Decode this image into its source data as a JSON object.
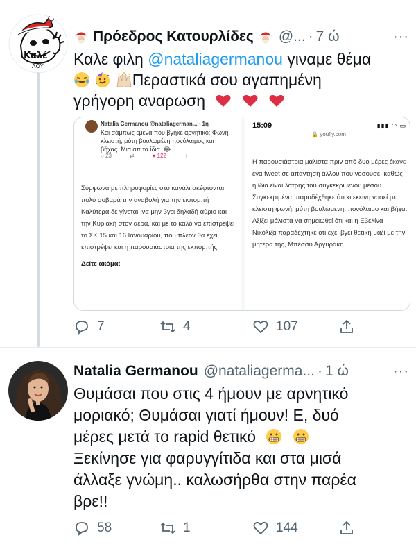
{
  "tweet1": {
    "name": "Πρόεδρος Κατουρλίδες",
    "handle": "@...",
    "time": "7 ώ",
    "more": "···",
    "text_line1_pre": "Καλε φιλη ",
    "mention": "@nataliagermanou",
    "text_line1_post": " γιναμε θέμα",
    "text_line2": "Περαστικά σου αγαπημένη",
    "text_line3": "γρήγορη αναρωση",
    "embedded": {
      "mini_name": "Natalia Germanou @nataliagerman... · 1η",
      "mini_body": "Και σάμπως εμένα που βγήκε αρνητικό; Φωνή κλειστή, μύτη βουλωμένη πονόλαιμος και βήχας. Μια απ τα ίδια. 😂",
      "mini_reply": "23",
      "mini_like": "122",
      "article_left": "Σύμφωνα με πληροφορίες στο κανάλι σκέφτονται πολύ σοβαρά την αναβολή για την εκπομπή Καλύτερα δε γίνεται, να μην βγει δηλαδή αύριο και την Κυριακή στον αέρα, και με το καλό να επιστρέψει το ΣΚ 15 και 16 Ιανουαρίου, που πλέον θα έχει επιστρέψει και η παρουσιάστρια της εκπομπής.",
      "see_more": "Δείτε ακόμα:",
      "phone_time": "15:09",
      "site": "youfly.com",
      "article_right": "Η παρουσιάστρια μάλιστα πριν από δυο μέρες έκανε ένα tweet σε απάντηση άλλου που νοσούσε, καθώς η ίδια είναι λάτρης του συγκεκριμένου μέσου. Συγκεκριμένα, παραδέχθηκε ότι κι εκείνη νοσεί με κλειστή φωνή, μύτη βουλωμένη, πονόλαιμο και βήχα. Αξίζει μάλιστα να σημειωθεί ότι και η Εβελίνα Νικόλιζα παραδέχτηκε ότι έχει βγει θετική μαζί με την μητέρα της, Μπέσσυ Αργυράκη."
    },
    "replies": "7",
    "retweets": "4",
    "likes": "107"
  },
  "tweet2": {
    "name": "Natalia Germanou",
    "handle": "@nataliagerma...",
    "time": "1 ώ",
    "more": "···",
    "line1": "Θυμάσαι που στις 4 ήμουν με αρνητικό",
    "line2": "μοριακό; Θυμάσαι γιατί ήμουν! Ε, δυό",
    "line3": "μέρες μετά το rapid θετικό",
    "line4": "Ξεκίνησε για φαρυγγίτιδα και στα μισά",
    "line5": "άλλαξε γνώμη.. καλωσήρθα στην παρέα",
    "line6": "βρε!!",
    "replies": "58",
    "retweets": "1",
    "likes": "144"
  },
  "colors": {
    "accent": "#1d9bf0",
    "muted": "#536471",
    "heart": "#e0245e"
  }
}
